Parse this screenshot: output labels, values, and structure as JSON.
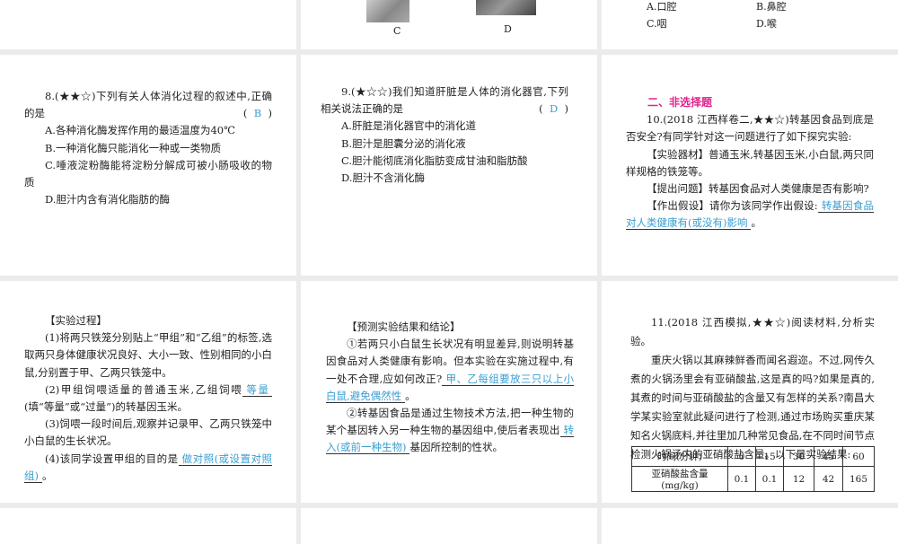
{
  "top": {
    "image_labels": [
      "C",
      "D"
    ],
    "options": [
      "A.口腔",
      "B.鼻腔",
      "C.咽",
      "D.喉"
    ]
  },
  "q8": {
    "stem1": "8.(★★☆)下列有关人体消化过程的叙述中,正确的是",
    "answer": "B",
    "options": [
      "A.各种消化酶发挥作用的最适温度为40℃",
      "B.一种消化酶只能消化一种或一类物质",
      "C.唾液淀粉酶能将淀粉分解成可被小肠吸收的物质",
      "D.胆汁内含有消化脂肪的酶"
    ]
  },
  "q9": {
    "stem1": "9.(★☆☆)我们知道肝脏是人体的消化器官,下列相关说法正确的是",
    "answer": "D",
    "options": [
      "A.肝脏是消化器官中的消化道",
      "B.胆汁是胆囊分泌的消化液",
      "C.胆汁能彻底消化脂肪变成甘油和脂肪酸",
      "D.胆汁不含消化酶"
    ]
  },
  "q10": {
    "section": "二、非选择题",
    "stem": "10.(2018 江西样卷二,★★☆)转基因食品到底是否安全?有同学针对这一问题进行了如下探究实验:",
    "materials": "【实验器材】普通玉米,转基因玉米,小白鼠,两只同样规格的铁笼等。",
    "question": "【提出问题】转基因食品对人类健康是否有影响?",
    "hypothesis_prefix": "【作出假设】请你为该同学作出假设:",
    "hypothesis_answer": "转基因食品对人类健康有(或没有)影响",
    "end": "。"
  },
  "process": {
    "title": "【实验过程】",
    "s1": "(1)将两只铁笼分别贴上“甲组”和“乙组”的标签,选取两只身体健康状况良好、大小一致、性别相同的小白鼠,分别置于甲、乙两只铁笼中。",
    "s2_prefix": "(2)甲组饲喂适量的普通玉米,乙组饲喂",
    "s2_answer": "等量",
    "s2_suffix": "(填“等量”或“过量”)的转基因玉米。",
    "s3": "(3)饲喂一段时间后,观察并记录甲、乙两只铁笼中小白鼠的生长状况。",
    "s4_prefix": "(4)该同学设置甲组的目的是",
    "s4_answer": "做对照(或设置对照组)",
    "end": "。"
  },
  "predict": {
    "title": "【预测实验结果和结论】",
    "p1_prefix": "①若两只小白鼠生长状况有明显差异,则说明转基因食品对人类健康有影响。但本实验在实施过程中,有一处不合理,应如何改正?",
    "p1_answer": "甲、乙每组要放三只以上小白鼠,避免偶然性",
    "end": "。",
    "p2_prefix": "②转基因食品是通过生物技术方法,把一种生物的某个基因转入另一种生物的基因组中,使后者表现出",
    "p2_answer": "转入(或前一种生物)",
    "p2_suffix": "基因所控制的性状。"
  },
  "q11": {
    "stem": "11.(2018 江西模拟,★★☆)阅读材料,分析实验。",
    "body": "重庆火锅以其麻辣鲜香而闻名遐迩。不过,网传久煮的火锅汤里会有亚硝酸盐,这是真的吗?如果是真的,其煮的时间与亚硝酸盐的含量又有怎样的关系?南昌大学某实验室就此疑问进行了检测,通过市场购买重庆某知名火锅底料,并往里加几种常见食品,在不同时间节点检测火锅汤内的亚硝酸盐含量。以下是实验结果:",
    "table": {
      "row1": [
        "时间(分钟)",
        "0",
        "15",
        "30",
        "45",
        "60"
      ],
      "row2": [
        "亚硝酸盐含量(mg/kg)",
        "0.1",
        "0.1",
        "12",
        "42",
        "165"
      ]
    }
  }
}
